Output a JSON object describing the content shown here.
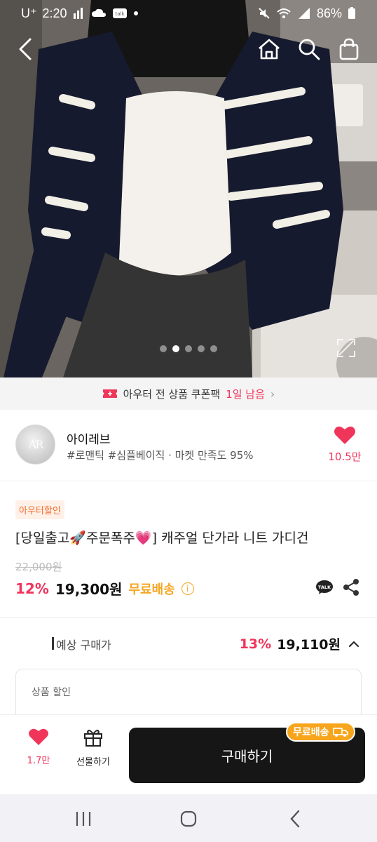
{
  "status_bar": {
    "carrier": "U⁺",
    "time": "2:20",
    "battery": "86%",
    "icons": [
      "signal-bars-icon",
      "cloud-icon",
      "message-icon",
      "dot-icon",
      "mute-icon",
      "wifi-icon",
      "cell-signal-icon",
      "battery-icon"
    ]
  },
  "nav": {
    "icons": [
      "back-icon",
      "home-icon",
      "search-icon",
      "shopping-bag-icon"
    ]
  },
  "gallery": {
    "total_images": 5,
    "active_index": 2
  },
  "coupon_banner": {
    "text": "아우터 전 상품 쿠폰팩",
    "highlight": "1일 남음"
  },
  "seller": {
    "name": "아이레브",
    "tags": "#로맨틱 #심플베이직 · 마켓 만족도 95%",
    "likes": "10.5만"
  },
  "product": {
    "badge": "아우터할인",
    "title": "[당일출고🚀주문폭주💗] 캐주얼 단가라 니트 가디건",
    "original_price": "22,000원",
    "discount": "12%",
    "price": "19,300원",
    "shipping": "무료배송",
    "info_symbol": "i"
  },
  "expected_price": {
    "label": "예상 구매가",
    "discount": "13%",
    "price": "19,110원"
  },
  "discount_detail": {
    "label": "상품 할인"
  },
  "bottom_bar": {
    "wish_count": "1.7만",
    "gift_label": "선물하기",
    "buy_label": "구매하기",
    "free_shipping_tag": "무료배송"
  },
  "colors": {
    "accent": "#f0355b",
    "shipping": "#f5a623",
    "buy_button": "#161616"
  }
}
